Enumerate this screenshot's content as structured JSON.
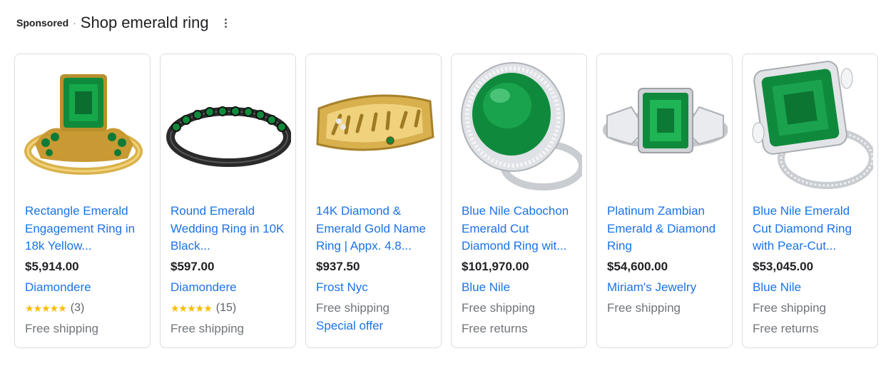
{
  "header": {
    "sponsored": "Sponsored",
    "separator": "·",
    "title": "Shop emerald ring"
  },
  "products": [
    {
      "title": "Rectangle Emerald Engagement Ring in 18k Yellow...",
      "price": "$5,914.00",
      "merchant": "Diamondere",
      "rating_stars": "★★★★★",
      "rating_count": "(3)",
      "shipping": "Free shipping",
      "image": "emerald-ring-gold"
    },
    {
      "title": "Round Emerald Wedding Ring in 10K Black...",
      "price": "$597.00",
      "merchant": "Diamondere",
      "rating_stars": "★★★★★",
      "rating_count": "(15)",
      "shipping": "Free shipping",
      "image": "emerald-band-black"
    },
    {
      "title": "14K Diamond & Emerald Gold Name Ring | Appx. 4.8...",
      "price": "$937.50",
      "merchant": "Frost Nyc",
      "shipping": "Free shipping",
      "offer": "Special offer",
      "image": "gold-name-ring"
    },
    {
      "title": "Blue Nile Cabochon Emerald Cut Diamond Ring wit...",
      "price": "$101,970.00",
      "merchant": "Blue Nile",
      "shipping": "Free shipping",
      "returns": "Free returns",
      "image": "cabochon-emerald-ring"
    },
    {
      "title": "Platinum Zambian Emerald & Diamond Ring",
      "price": "$54,600.00",
      "merchant": "Miriam's Jewelry",
      "shipping": "Free shipping",
      "image": "platinum-emerald-ring"
    },
    {
      "title": "Blue Nile Emerald Cut Diamond Ring with Pear-Cut...",
      "price": "$53,045.00",
      "merchant": "Blue Nile",
      "shipping": "Free shipping",
      "returns": "Free returns",
      "image": "emerald-cut-pear-ring"
    }
  ],
  "colors": {
    "link": "#1a73e8",
    "star": "#fbbc04",
    "border": "#dadce0",
    "emerald": "#0f8a3c"
  }
}
